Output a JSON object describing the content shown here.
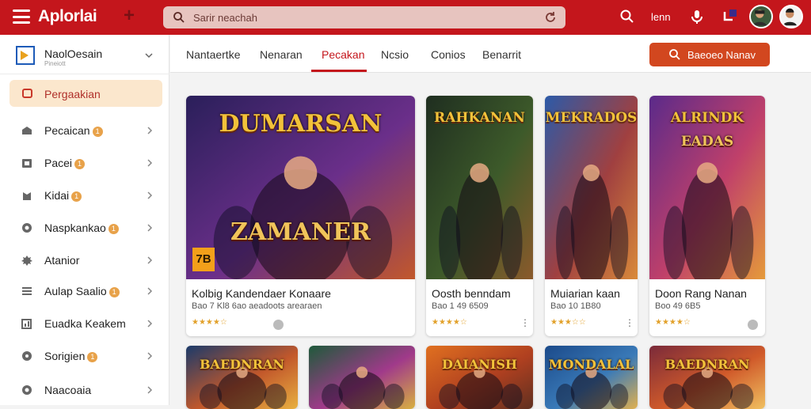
{
  "header": {
    "app_title": "Aplorlai",
    "search_placeholder": "Sarir neachah",
    "text_link": "lenn",
    "bell_count": "1"
  },
  "sidebar": {
    "account_name": "NaolOesain",
    "account_sub": "Pineiott",
    "active_item": "Pergaakian",
    "items": [
      {
        "label": "Pecaican",
        "badge": "1",
        "icon": "store-icon"
      },
      {
        "label": "Pacei",
        "badge": "1",
        "icon": "box-icon"
      },
      {
        "label": "Kidai",
        "badge": "1",
        "icon": "bookmark-icon"
      },
      {
        "label": "Naspkankao",
        "badge": "1",
        "icon": "globe-icon"
      },
      {
        "label": "Atanior",
        "badge": "",
        "icon": "settings-icon"
      },
      {
        "label": "Aulap Saalio",
        "badge": "1",
        "icon": "list-icon"
      },
      {
        "label": "Euadka Keakem",
        "badge": "",
        "icon": "chart-icon"
      },
      {
        "label": "Sorigien",
        "badge": "1",
        "icon": "help-icon"
      },
      {
        "label": "Naacoaia",
        "badge": "",
        "icon": "gear-icon"
      }
    ]
  },
  "tabs": {
    "items": [
      "Nantaertke",
      "Nenaran",
      "Pecakan",
      "Ncsio",
      "Conios",
      "Benarrit"
    ],
    "active_index": 2,
    "cta_label": "Baeoeo Nanav"
  },
  "cards": [
    {
      "title": "Kolbig Kandendaer Konaare",
      "meta": "Bao 7 Kl8 6ao aeadoots arearaen",
      "stars": "★★★★☆",
      "art_top": "DUMARSAN",
      "art_bottom": "ZAMANER",
      "badge": "7B"
    },
    {
      "title": "Oosth benndam",
      "meta": "Bao 1 49 6509",
      "stars": "★★★★☆",
      "art_top": "RAHKANAN",
      "art_bottom": "",
      "badge": ""
    },
    {
      "title": "Muiarian kaan",
      "meta": "Bao 10 1B80",
      "stars": "★★★☆☆",
      "art_top": "MEKRADOS",
      "art_bottom": "",
      "badge": ""
    },
    {
      "title": "Doon Rang Nanan",
      "meta": "Boo 49 6B5",
      "stars": "★★★★☆",
      "art_top": "ALRINDK",
      "art_bottom": "EADAS",
      "badge": ""
    },
    {
      "title": "",
      "meta": "",
      "stars": "",
      "art_top": "BAEDNRAN",
      "art_bottom": "",
      "badge": ""
    },
    {
      "title": "",
      "meta": "",
      "stars": "",
      "art_top": "",
      "art_bottom": "",
      "badge": ""
    },
    {
      "title": "",
      "meta": "",
      "stars": "",
      "art_top": "DAIANISH",
      "art_bottom": "",
      "badge": ""
    },
    {
      "title": "",
      "meta": "",
      "stars": "",
      "art_top": "MONDALAL",
      "art_bottom": "",
      "badge": ""
    },
    {
      "title": "",
      "meta": "",
      "stars": "",
      "art_top": "BAEDNRAN",
      "art_bottom": "",
      "badge": ""
    }
  ],
  "colors": {
    "brand_red": "#c4161c",
    "cta_orange": "#d2471f",
    "active_nav_bg": "#fbe7cd",
    "star_gold": "#e2a12a"
  }
}
